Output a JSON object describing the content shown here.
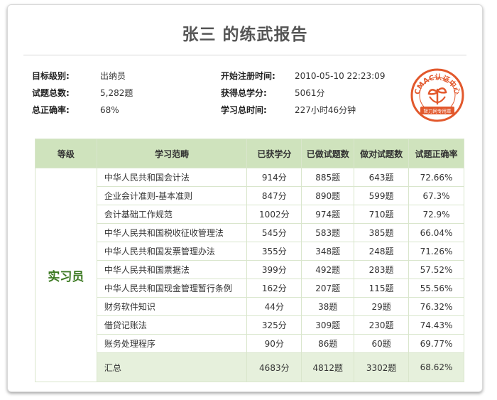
{
  "title": "张三 的练武报告",
  "info_left": [
    {
      "label": "目标级别:",
      "value": "出纳员"
    },
    {
      "label": "试题总数:",
      "value": "5,282题"
    },
    {
      "label": "总正确率:",
      "value": "68%"
    }
  ],
  "info_right": [
    {
      "label": "开始注册时间:",
      "value": "2010-05-10 22:23:09"
    },
    {
      "label": "获得总学分:",
      "value": "5061分"
    },
    {
      "label": "学习总时间:",
      "value": "227小时46分钟"
    }
  ],
  "stamp": {
    "text": "CMAC认证中心",
    "subtext": "智刀网专用章",
    "color": "#e2582c"
  },
  "table": {
    "headers": [
      "等级",
      "学习范畴",
      "已获学分",
      "已做试题数",
      "做对试题数",
      "试题正确率"
    ],
    "level": "实习员",
    "rows": [
      [
        "中华人民共和国会计法",
        "914分",
        "885题",
        "643题",
        "72.66%"
      ],
      [
        "企业会计准则-基本准则",
        "847分",
        "890题",
        "599题",
        "67.3%"
      ],
      [
        "会计基础工作规范",
        "1002分",
        "974题",
        "710题",
        "72.9%"
      ],
      [
        "中华人民共和国税收征收管理法",
        "545分",
        "583题",
        "385题",
        "66.04%"
      ],
      [
        "中华人民共和国发票管理办法",
        "355分",
        "348题",
        "248题",
        "71.26%"
      ],
      [
        "中华人民共和国票据法",
        "399分",
        "492题",
        "283题",
        "57.52%"
      ],
      [
        "中华人民共和国现金管理暂行条例",
        "162分",
        "207题",
        "115题",
        "55.56%"
      ],
      [
        "财务软件知识",
        "44分",
        "38题",
        "29题",
        "76.32%"
      ],
      [
        "借贷记账法",
        "325分",
        "309题",
        "230题",
        "74.43%"
      ],
      [
        "账务处理程序",
        "90分",
        "86题",
        "60题",
        "69.77%"
      ]
    ],
    "total": [
      "汇总",
      "4683分",
      "4812题",
      "3302题",
      "68.62%"
    ]
  }
}
